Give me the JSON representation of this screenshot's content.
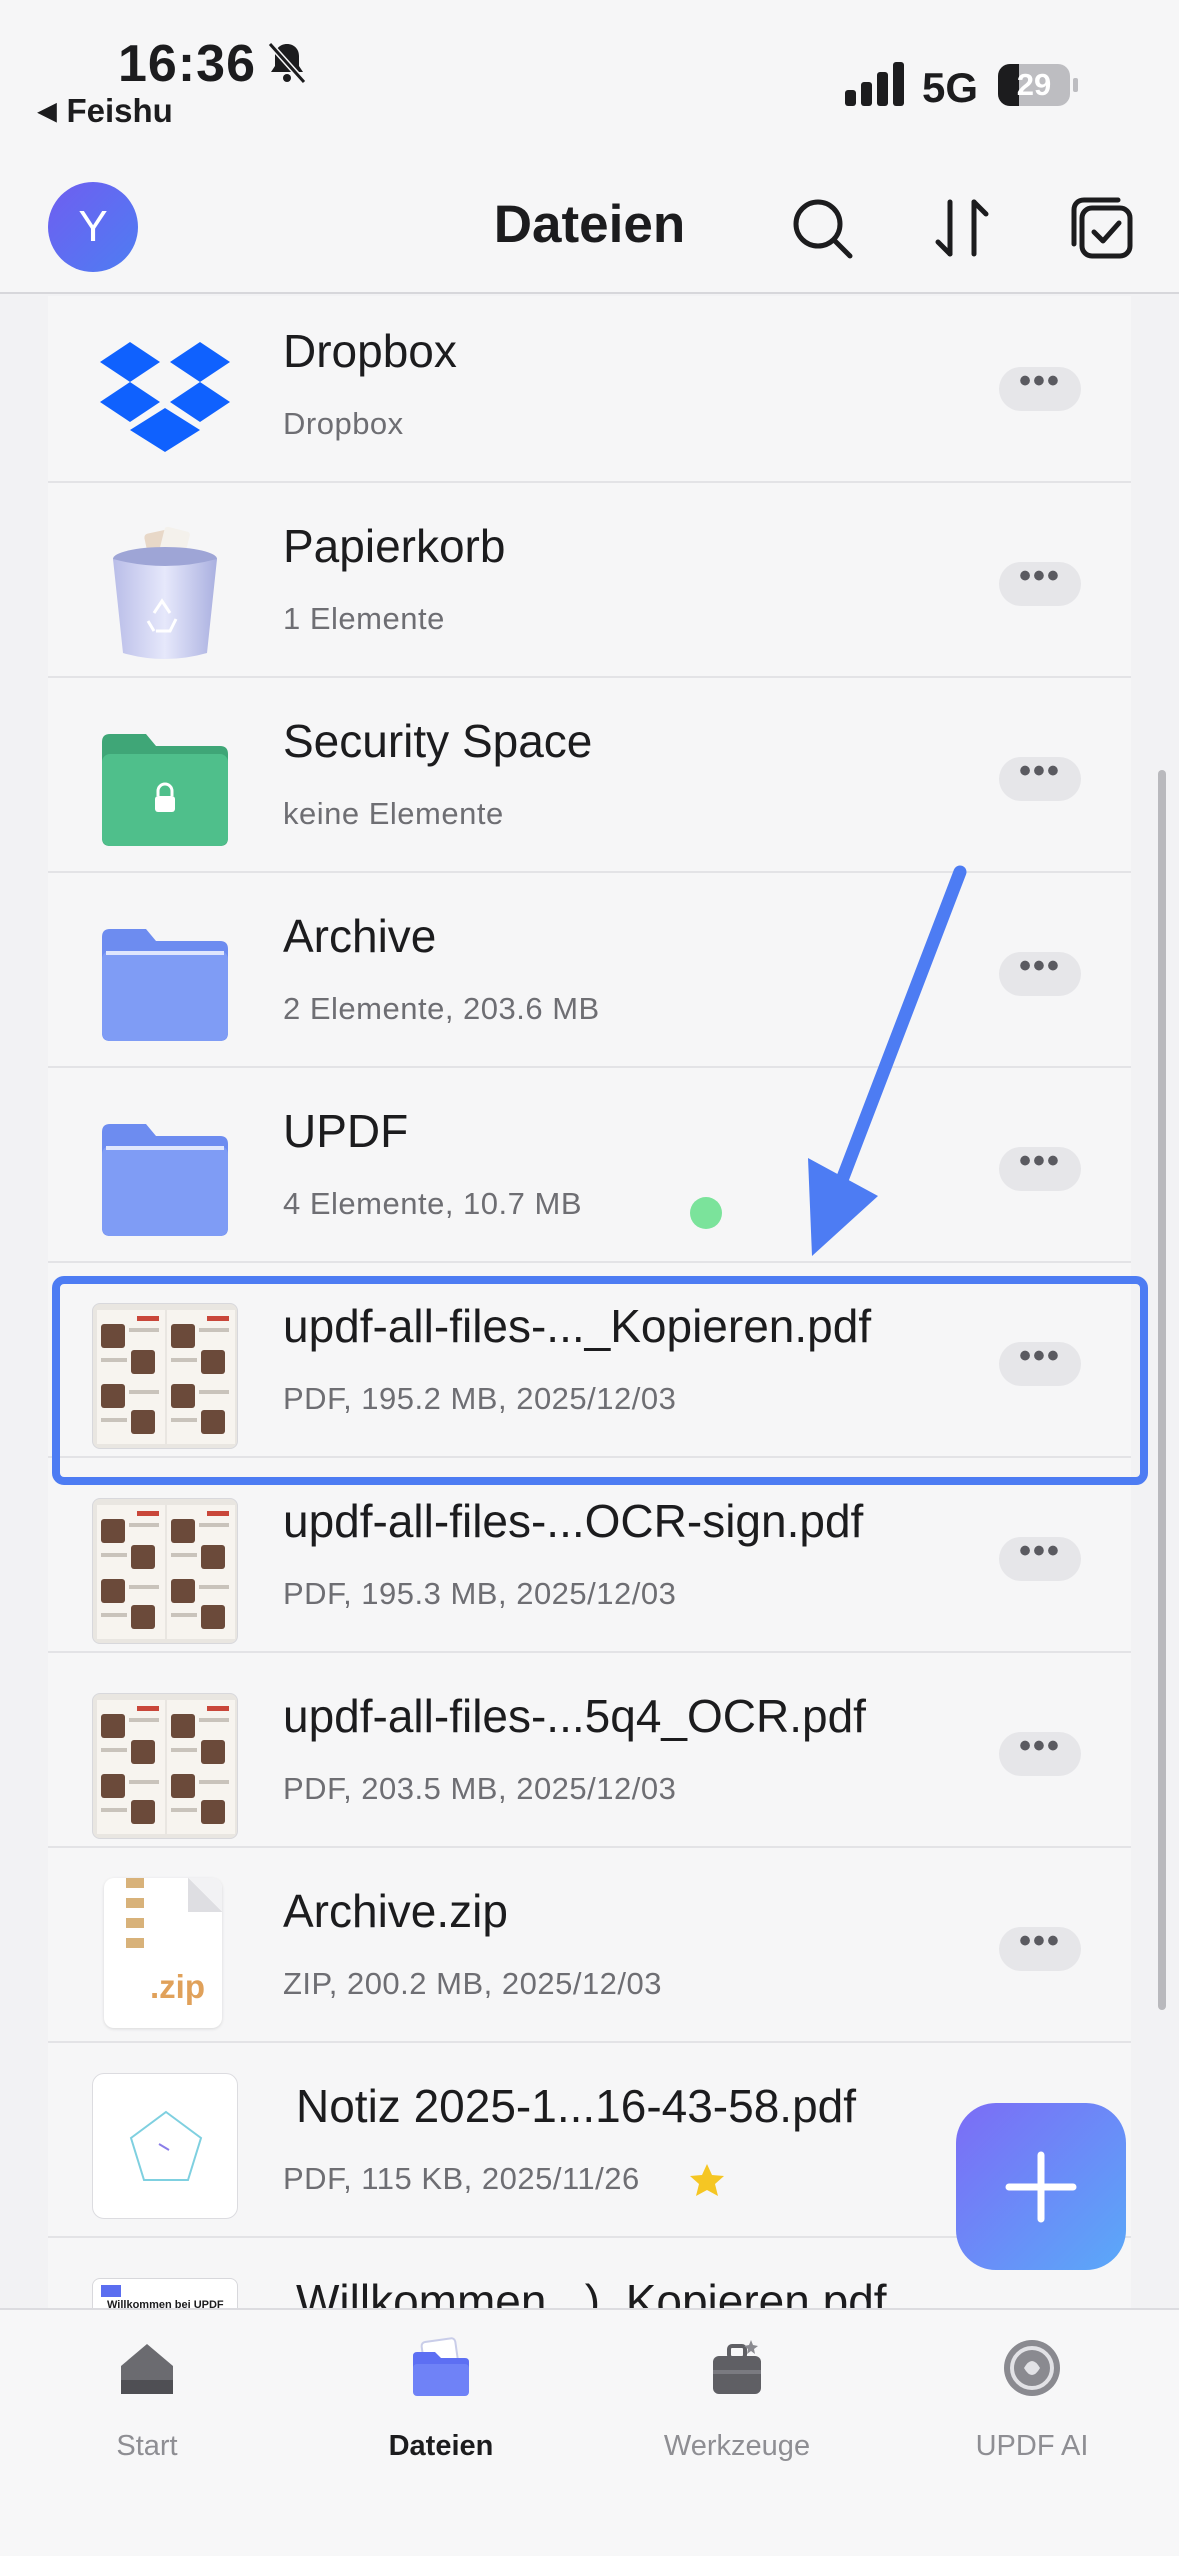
{
  "status_bar": {
    "time": "16:36",
    "back_app": "Feishu",
    "network": "5G",
    "battery_level": "29",
    "battery_fraction": 0.29
  },
  "header": {
    "avatar_letter": "Y",
    "title": "Dateien"
  },
  "files": [
    {
      "title": "Dropbox",
      "subtitle": "Dropbox",
      "icon": "dropbox-icon"
    },
    {
      "title": "Papierkorb",
      "subtitle": "1 Elemente",
      "icon": "trash-bin-icon"
    },
    {
      "title": "Security Space",
      "subtitle": "keine Elemente",
      "icon": "locked-folder-icon"
    },
    {
      "title": "Archive",
      "subtitle": "2 Elemente, 203.6 MB",
      "icon": "folder-icon"
    },
    {
      "title": "UPDF",
      "subtitle": "4 Elemente, 10.7 MB",
      "icon": "folder-icon",
      "status": "synced"
    },
    {
      "title": "updf-all-files-..._Kopieren.pdf",
      "subtitle": "PDF, 195.2 MB, 2025/12/03",
      "icon": "pdf-thumbnail",
      "selected": true
    },
    {
      "title": "updf-all-files-...OCR-sign.pdf",
      "subtitle": "PDF, 195.3 MB, 2025/12/03",
      "icon": "pdf-thumbnail"
    },
    {
      "title": "updf-all-files-...5q4_OCR.pdf",
      "subtitle": "PDF, 203.5 MB, 2025/12/03",
      "icon": "pdf-thumbnail"
    },
    {
      "title": "Archive.zip",
      "subtitle": "ZIP, 200.2 MB, 2025/12/03",
      "icon": "zip-file-icon"
    },
    {
      "title": "Notiz 2025-1...16-43-58.pdf",
      "subtitle": "PDF, 115 KB, 2025/11/26",
      "icon": "note-thumbnail",
      "starred": true
    },
    {
      "title": "Willkommen...)_Kopieren.pdf",
      "subtitle": "",
      "icon": "pdf-thumbnail"
    }
  ],
  "more_label": "•••",
  "zip_label": ".zip",
  "thumb_texts": {
    "welcome": "Willkommen bei UPDF"
  },
  "tabs": [
    {
      "label": "Start",
      "icon": "home-icon",
      "active": false
    },
    {
      "label": "Dateien",
      "icon": "files-icon",
      "active": true
    },
    {
      "label": "Werkzeuge",
      "icon": "toolbox-icon",
      "active": false
    },
    {
      "label": "UPDF AI",
      "icon": "ai-icon",
      "active": false
    }
  ],
  "colors": {
    "accent": "#4d7cf3",
    "folder": "#7f9cf5",
    "security_folder": "#4fbf8b",
    "dropbox": "#0f61fe",
    "star": "#f5c623",
    "sync_dot": "#7be39b"
  }
}
